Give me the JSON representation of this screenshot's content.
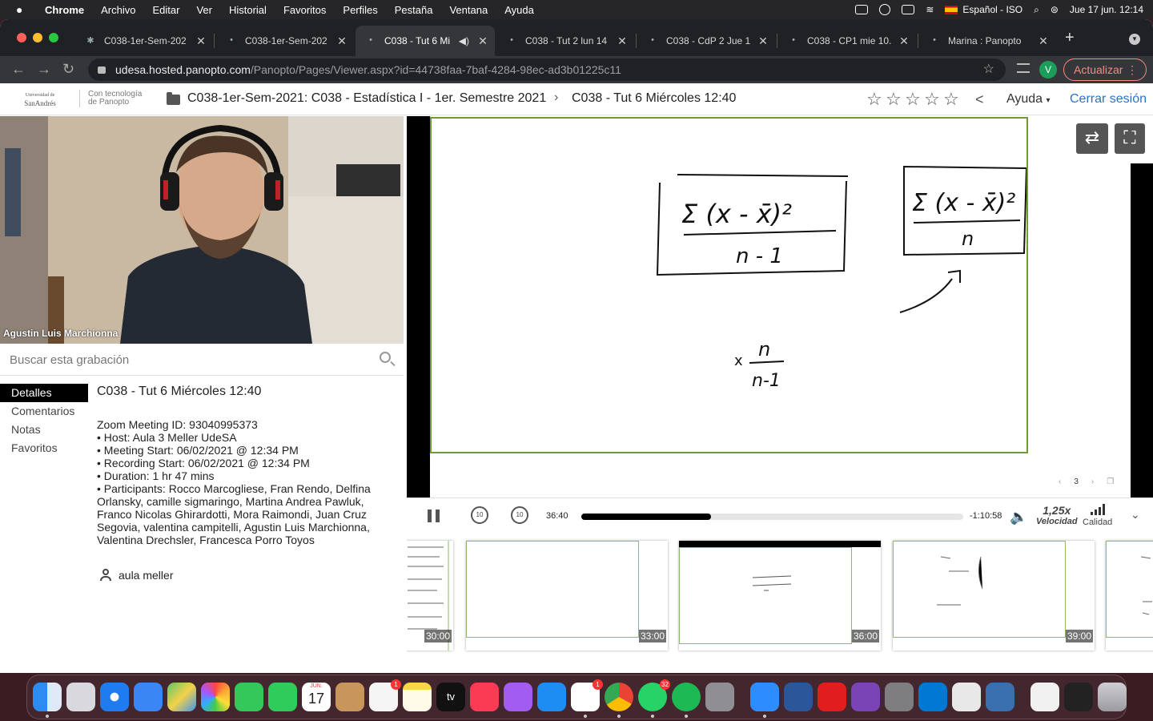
{
  "menubar": {
    "app": "Chrome",
    "items": [
      "Archivo",
      "Editar",
      "Ver",
      "Historial",
      "Favoritos",
      "Perfiles",
      "Pestaña",
      "Ventana",
      "Ayuda"
    ],
    "input_source": "Español - ISO",
    "datetime": "Jue 17 jun.  12:14"
  },
  "browser": {
    "tabs": [
      {
        "title": "C038-1er-Sem-202"
      },
      {
        "title": "C038-1er-Sem-202"
      },
      {
        "title": "C038 - Tut 6 Mi"
      },
      {
        "title": "C038 - Tut 2 lun 14"
      },
      {
        "title": "C038 - CdP 2 Jue 1"
      },
      {
        "title": "C038 - CP1 mie 10."
      },
      {
        "title": "Marina : Panopto"
      }
    ],
    "url_host": "udesa.hosted.panopto.com",
    "url_path": "/Panopto/Pages/Viewer.aspx?id=44738faa-7baf-4284-98ec-ad3b01225c11",
    "profile_initial": "V",
    "update_label": "Actualizar"
  },
  "header": {
    "logo_line1": "Universidad de",
    "logo_line2": "SanAndrés",
    "powered_line1": "Con tecnología",
    "powered_line2": "de Panopto",
    "folder": "C038-1er-Sem-2021: C038 - Estadística I - 1er. Semestre 2021",
    "session": "C038 - Tut 6 Miércoles 12:40",
    "help": "Ayuda",
    "signout": "Cerrar sesión"
  },
  "webcam": {
    "name": "Agustin Luis Marchionna"
  },
  "search": {
    "placeholder": "Buscar esta grabación"
  },
  "sidenav": [
    "Detalles",
    "Comentarios",
    "Notas",
    "Favoritos"
  ],
  "details": {
    "title": "C038 - Tut 6 Miércoles 12:40",
    "lines": [
      "Zoom Meeting ID: 93040995373",
      "• Host: Aula 3 Meller UdeSA",
      "• Meeting Start: 06/02/2021 @ 12:34 PM",
      "• Recording Start: 06/02/2021 @ 12:34 PM",
      "• Duration: 1 hr 47 mins",
      "• Participants: Rocco Marcogliese, Fran Rendo, Delfina Orlansky, camille sigmaringo, Martina Andrea Pawluk, Franco Nicolas Ghirardotti, Mora Raimondi, Juan Cruz Segovia, valentina campitelli, Agustin Luis Marchionna, Valentina Drechsler, Francesca Porro Toyos"
    ],
    "owner": "aula meller"
  },
  "player": {
    "elapsed": "36:40",
    "remaining": "-1:10:58",
    "progress": 0.34,
    "skip_seconds": "10",
    "speed": "1,25x",
    "speed_label": "Velocidad",
    "quality_label": "Calidad",
    "slide_number": "3"
  },
  "board": {
    "formula1_top": "Σ (x - x̄)²",
    "formula1_bottom": "n - 1",
    "formula2_top": "Σ (x - x̄)²",
    "formula2_bottom": "n",
    "multiplier_prefix": "x",
    "multiplier_top": "n",
    "multiplier_bottom": "n-1"
  },
  "thumbnails": [
    {
      "time": "30:00"
    },
    {
      "time": "33:00"
    },
    {
      "time": "36:00"
    },
    {
      "time": "39:00"
    }
  ],
  "dock": {
    "calendar_month": "JUN.",
    "calendar_day": "17",
    "reminders_badge": "1",
    "slack_badge": "1",
    "whatsapp_badge": "32",
    "appletv_label": "tv"
  },
  "colors": {
    "board_border": "#6b9c35",
    "link_blue": "#2a72c8",
    "update_red": "#f28b82"
  }
}
